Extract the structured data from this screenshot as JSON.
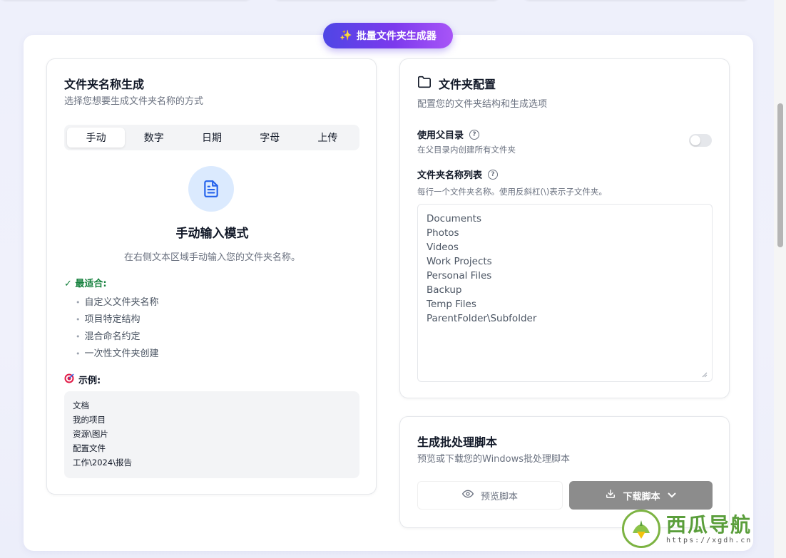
{
  "header": {
    "badge": "批量文件夹生成器"
  },
  "left_card": {
    "title": "文件夹名称生成",
    "subtitle": "选择您想要生成文件夹名称的方式",
    "tabs": [
      {
        "label": "手动"
      },
      {
        "label": "数字"
      },
      {
        "label": "日期"
      },
      {
        "label": "字母"
      },
      {
        "label": "上传"
      }
    ],
    "mode_title": "手动输入模式",
    "mode_desc": "在右侧文本区域手动输入您的文件夹名称。",
    "best_for_title": "✓ 最适合:",
    "best_for": [
      "自定义文件夹名称",
      "项目特定结构",
      "混合命名约定",
      "一次性文件夹创建"
    ],
    "example_title": "示例:",
    "examples": [
      "文档",
      "我的项目",
      "资源\\图片",
      "配置文件",
      "工作\\2024\\报告"
    ]
  },
  "config_card": {
    "title": "文件夹配置",
    "subtitle": "配置您的文件夹结构和生成选项",
    "parent_label": "使用父目录",
    "parent_hint": "在父目录内创建所有文件夹",
    "parent_enabled": false,
    "names_label": "文件夹名称列表",
    "names_hint": "每行一个文件夹名称。使用反斜杠(\\)表示子文件夹。",
    "names_value": "Documents\nPhotos\nVideos\nWork Projects\nPersonal Files\nBackup\nTemp Files\nParentFolder\\Subfolder"
  },
  "script_card": {
    "title": "生成批处理脚本",
    "subtitle": "预览或下载您的Windows批处理脚本",
    "preview_label": "预览脚本",
    "download_label": "下载脚本"
  },
  "watermark": {
    "title": "西瓜导航",
    "url": "https://xgdh.cn"
  }
}
